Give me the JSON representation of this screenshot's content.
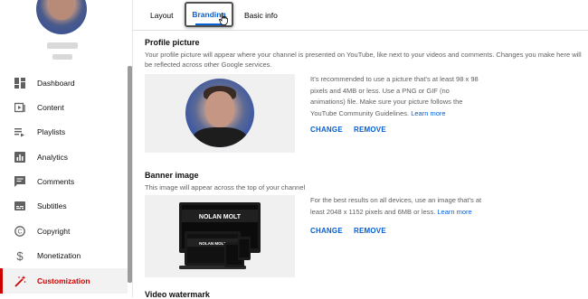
{
  "sidebar": {
    "items": [
      {
        "label": "Dashboard",
        "icon": "dashboard-icon"
      },
      {
        "label": "Content",
        "icon": "content-icon"
      },
      {
        "label": "Playlists",
        "icon": "playlists-icon"
      },
      {
        "label": "Analytics",
        "icon": "analytics-icon"
      },
      {
        "label": "Comments",
        "icon": "comments-icon"
      },
      {
        "label": "Subtitles",
        "icon": "subtitles-icon"
      },
      {
        "label": "Copyright",
        "icon": "copyright-icon"
      },
      {
        "label": "Monetization",
        "icon": "monetization-icon"
      },
      {
        "label": "Customization",
        "icon": "customization-icon"
      }
    ],
    "active_item": "Customization",
    "accent_color": "#cc0000"
  },
  "tabs": {
    "layout": "Layout",
    "branding": "Branding",
    "basic_info": "Basic info",
    "active": "Branding"
  },
  "profile_picture": {
    "title": "Profile picture",
    "description": "Your profile picture will appear where your channel is presented on YouTube, like next to your videos and comments. Changes you make here will be reflected across other Google services.",
    "help_lines": [
      "It’s recommended to use a picture that’s at least 98 x 98",
      "pixels and 4MB or less. Use a PNG or GIF (no",
      "animations) file. Make sure your picture follows the",
      "YouTube Community Guidelines."
    ],
    "learn_more": "Learn more",
    "change": "CHANGE",
    "remove": "REMOVE"
  },
  "banner_image": {
    "title": "Banner image",
    "description": "This image will appear across the top of your channel",
    "help_lines": [
      "For the best results on all devices, use an image that’s at",
      "least 2048 x 1152 pixels and 6MB or less."
    ],
    "learn_more": "Learn more",
    "change": "CHANGE",
    "remove": "REMOVE",
    "preview_text": "NOLAN MOLT"
  },
  "video_watermark": {
    "title": "Video watermark"
  },
  "colors": {
    "link_blue": "#065fd4",
    "secondary_text": "#606060"
  }
}
